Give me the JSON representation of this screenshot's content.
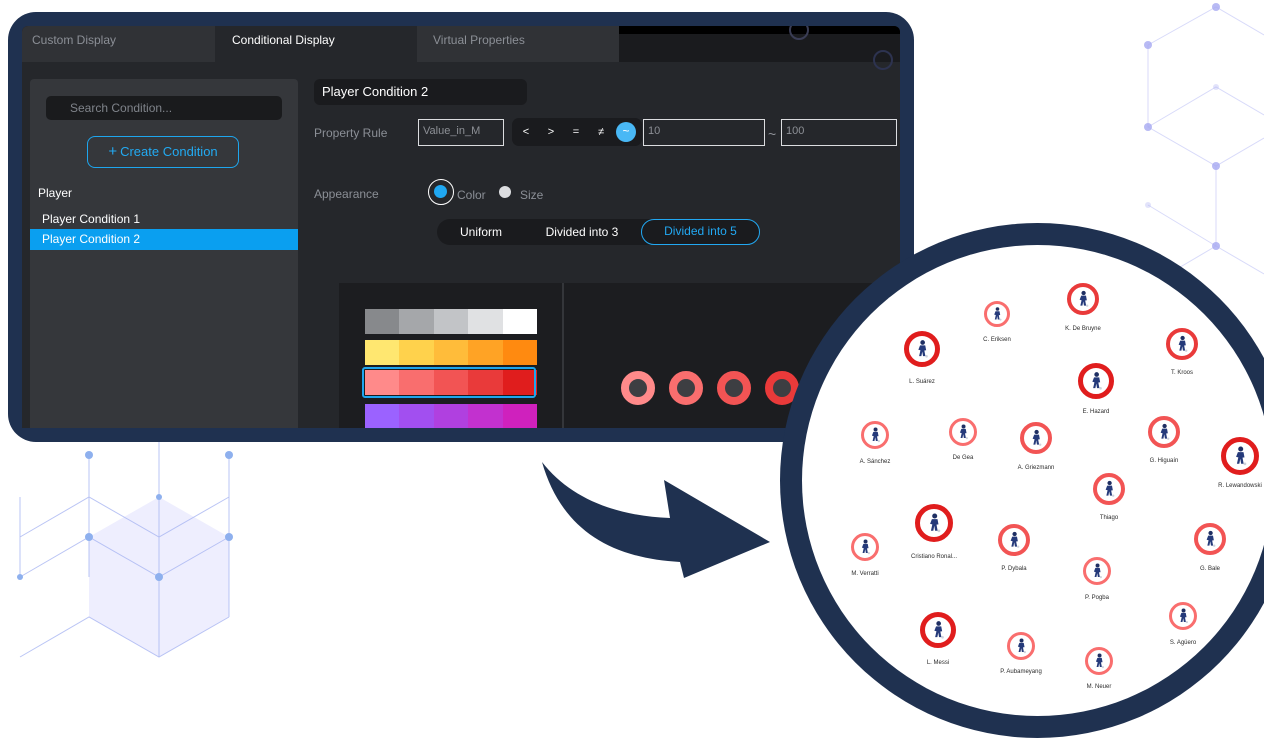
{
  "tabs": [
    {
      "label": "Custom Display"
    },
    {
      "label": "Conditional Display"
    },
    {
      "label": "Virtual Properties"
    }
  ],
  "sidebar": {
    "search_placeholder": "Search Condition...",
    "create_label": "Create Condition",
    "group_label": "Player",
    "items": [
      {
        "label": "Player Condition 1"
      },
      {
        "label": "Player Condition 2"
      }
    ]
  },
  "main": {
    "title": "Player Condition 2",
    "property_rule_label": "Property Rule",
    "property_value": "Value_in_M",
    "operators": [
      "<",
      ">",
      "=",
      "≠",
      "~"
    ],
    "min_value": "10",
    "range_separator": "~",
    "max_value": "100",
    "appearance_label": "Appearance",
    "appearance_options": [
      {
        "label": "Color",
        "selected": true
      },
      {
        "label": "Size",
        "selected": false
      }
    ],
    "division_options": [
      {
        "label": "Uniform"
      },
      {
        "label": "Divided into 3"
      },
      {
        "label": "Divided into 5"
      }
    ]
  },
  "palettes": [
    [
      "#87898c",
      "#a5a7aa",
      "#c2c4c7",
      "#e0e1e3",
      "#ffffff"
    ],
    [
      "#ffe770",
      "#ffd24c",
      "#ffbc3a",
      "#ffa325",
      "#ff8a10"
    ],
    [
      "#ff8a8a",
      "#f96e6e",
      "#f25454",
      "#e93a3a",
      "#e01d1d"
    ],
    [
      "#9b62ff",
      "#a24ff0",
      "#b040e0",
      "#c231cf",
      "#cf21bd"
    ]
  ],
  "preview_colors": [
    "#ff8a8a",
    "#f96e6e",
    "#f25454",
    "#e93a3a"
  ],
  "colors": {
    "accent": "#1ea6ee",
    "frame": "#1f3150"
  },
  "players": [
    {
      "name": "K. De Bruyne",
      "color": "#e93a3a"
    },
    {
      "name": "C. Eriksen",
      "color": "#f96e6e"
    },
    {
      "name": "T. Kroos",
      "color": "#e93a3a"
    },
    {
      "name": "L. Suárez",
      "color": "#e01d1d"
    },
    {
      "name": "E. Hazard",
      "color": "#e01d1d"
    },
    {
      "name": "A. Sánchez",
      "color": "#f96e6e"
    },
    {
      "name": "De Gea",
      "color": "#f96e6e"
    },
    {
      "name": "A. Griezmann",
      "color": "#f25454"
    },
    {
      "name": "G. Higuaín",
      "color": "#f25454"
    },
    {
      "name": "R. Lewandowski",
      "color": "#e01d1d"
    },
    {
      "name": "Thiago",
      "color": "#f25454"
    },
    {
      "name": "Cristiano Ronal...",
      "color": "#e01d1d"
    },
    {
      "name": "M. Verratti",
      "color": "#f96e6e"
    },
    {
      "name": "P. Dybala",
      "color": "#f25454"
    },
    {
      "name": "G. Bale",
      "color": "#f25454"
    },
    {
      "name": "P. Pogba",
      "color": "#f96e6e"
    },
    {
      "name": "S. Agüero",
      "color": "#f96e6e"
    },
    {
      "name": "L. Messi",
      "color": "#e01d1d"
    },
    {
      "name": "P. Aubameyang",
      "color": "#f96e6e"
    },
    {
      "name": "M. Neuer",
      "color": "#f96e6e"
    }
  ]
}
